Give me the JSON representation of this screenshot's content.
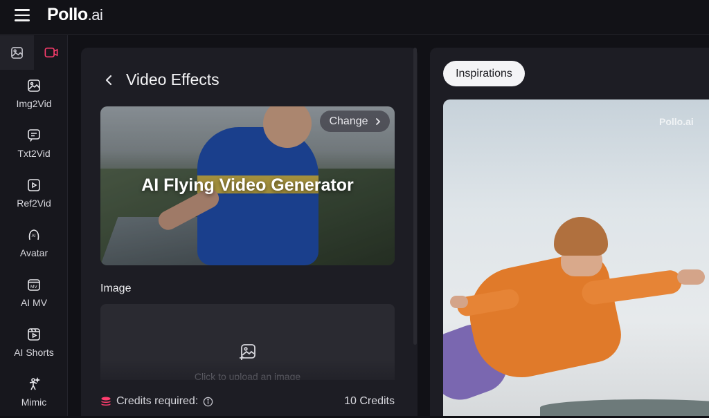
{
  "app": {
    "logo_main": "Pollo",
    "logo_tld": ".ai"
  },
  "sidebar": {
    "mode_tabs": [
      {
        "name": "image",
        "icon": "image-icon",
        "active": false
      },
      {
        "name": "video",
        "icon": "video-icon",
        "active": true,
        "color": "#ff3d6e"
      }
    ],
    "items": [
      {
        "label": "Img2Vid",
        "icon": "image-to-video-icon"
      },
      {
        "label": "Txt2Vid",
        "icon": "text-to-video-icon"
      },
      {
        "label": "Ref2Vid",
        "icon": "reference-to-video-icon"
      },
      {
        "label": "Avatar",
        "icon": "avatar-ai-icon"
      },
      {
        "label": "AI MV",
        "icon": "music-video-icon"
      },
      {
        "label": "AI Shorts",
        "icon": "shorts-icon"
      },
      {
        "label": "Mimic",
        "icon": "mimic-icon"
      }
    ]
  },
  "panel": {
    "title": "Video Effects",
    "effect_title": "AI Flying Video Generator",
    "change_label": "Change",
    "image_section_label": "Image",
    "upload_text": "Click to upload an image",
    "credits_label": "Credits required:",
    "credits_value": "10 Credits",
    "credits_icon_color": "#ff3d6e"
  },
  "right_panel": {
    "tab_label": "Inspirations",
    "watermark": "Pollo.ai"
  }
}
